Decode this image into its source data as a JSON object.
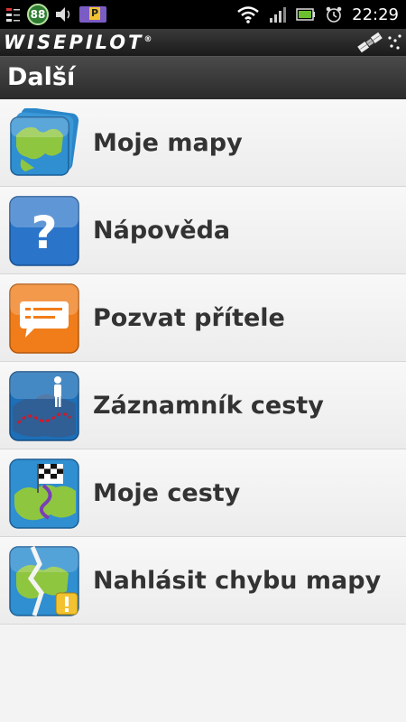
{
  "status_bar": {
    "notification_count": "88",
    "parking_badge": "P",
    "time": "22:29",
    "icons": [
      "notification-list-icon",
      "count-badge-icon",
      "volume-icon",
      "parking-icon",
      "wifi-icon",
      "signal-icon",
      "battery-icon",
      "alarm-icon"
    ]
  },
  "app_bar": {
    "brand": "WISEPILOT",
    "registered": "®",
    "gps_icon": "satellite-icon"
  },
  "title_bar": {
    "title": "Další"
  },
  "menu": {
    "items": [
      {
        "label": "Moje mapy",
        "icon": "maps-stack-icon"
      },
      {
        "label": "Nápověda",
        "icon": "help-icon"
      },
      {
        "label": "Pozvat přítele",
        "icon": "message-icon"
      },
      {
        "label": "Záznamník cesty",
        "icon": "trip-recorder-icon"
      },
      {
        "label": "Moje cesty",
        "icon": "my-routes-icon"
      },
      {
        "label": "Nahlásit chybu mapy",
        "icon": "report-map-error-icon"
      }
    ]
  },
  "colors": {
    "status_bar": "#000000",
    "title_bar": "#3a3a3a",
    "list_background": "#f3f3f3",
    "label_text": "#333333",
    "help_blue": "#2a74c9",
    "invite_orange": "#f07d1a",
    "map_green": "#8fc640",
    "map_sea": "#2f8fd0"
  }
}
